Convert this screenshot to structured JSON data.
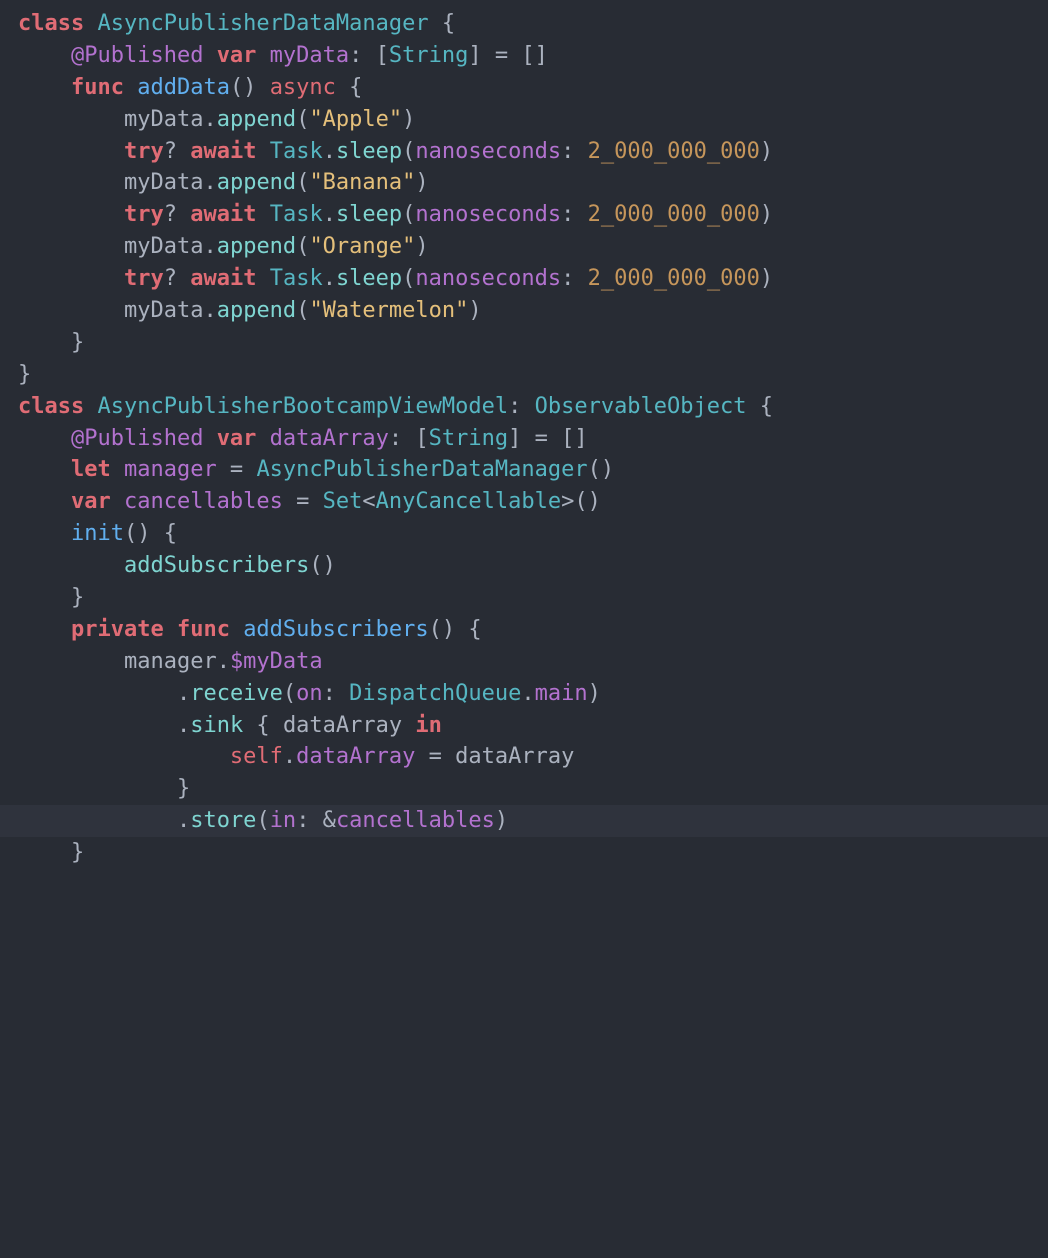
{
  "language": "swift",
  "theme": "one-dark",
  "highlighted_line_index": 34,
  "lines": [
    {
      "indent": 0,
      "tokens": [
        {
          "t": "class ",
          "c": "kw-strong"
        },
        {
          "t": "AsyncPublisherDataManager",
          "c": "type"
        },
        {
          "t": " {",
          "c": "punct"
        }
      ]
    },
    {
      "indent": 1,
      "tokens": [
        {
          "t": "@Published ",
          "c": "attr"
        },
        {
          "t": "var ",
          "c": "kw-strong"
        },
        {
          "t": "myData",
          "c": "prop"
        },
        {
          "t": ": [",
          "c": "punct"
        },
        {
          "t": "String",
          "c": "type2"
        },
        {
          "t": "] = []",
          "c": "punct"
        }
      ]
    },
    {
      "indent": 0,
      "tokens": [
        {
          "t": "",
          "c": "punct"
        }
      ]
    },
    {
      "indent": 1,
      "tokens": [
        {
          "t": "func ",
          "c": "kw-strong"
        },
        {
          "t": "addData",
          "c": "def"
        },
        {
          "t": "() ",
          "c": "punct"
        },
        {
          "t": "async",
          "c": "async"
        },
        {
          "t": " {",
          "c": "punct"
        }
      ]
    },
    {
      "indent": 2,
      "tokens": [
        {
          "t": "myData",
          "c": "ident"
        },
        {
          "t": ".",
          "c": "punct"
        },
        {
          "t": "append",
          "c": "fn"
        },
        {
          "t": "(",
          "c": "punct"
        },
        {
          "t": "\"Apple\"",
          "c": "str"
        },
        {
          "t": ")",
          "c": "punct"
        }
      ]
    },
    {
      "indent": 2,
      "tokens": [
        {
          "t": "try",
          "c": "kw-strong"
        },
        {
          "t": "? ",
          "c": "punct"
        },
        {
          "t": "await ",
          "c": "kw-strong"
        },
        {
          "t": "Task",
          "c": "type2"
        },
        {
          "t": ".",
          "c": "punct"
        },
        {
          "t": "sleep",
          "c": "fn"
        },
        {
          "t": "(",
          "c": "punct"
        },
        {
          "t": "nanoseconds",
          "c": "prop"
        },
        {
          "t": ": ",
          "c": "punct"
        },
        {
          "t": "2_000_000_000",
          "c": "num"
        },
        {
          "t": ")",
          "c": "punct"
        }
      ]
    },
    {
      "indent": 2,
      "tokens": [
        {
          "t": "myData",
          "c": "ident"
        },
        {
          "t": ".",
          "c": "punct"
        },
        {
          "t": "append",
          "c": "fn"
        },
        {
          "t": "(",
          "c": "punct"
        },
        {
          "t": "\"Banana\"",
          "c": "str"
        },
        {
          "t": ")",
          "c": "punct"
        }
      ]
    },
    {
      "indent": 2,
      "tokens": [
        {
          "t": "try",
          "c": "kw-strong"
        },
        {
          "t": "? ",
          "c": "punct"
        },
        {
          "t": "? ",
          "c": "hidden"
        },
        {
          "t": "await ",
          "c": "kw-strong"
        },
        {
          "t": "Task",
          "c": "type2"
        },
        {
          "t": ".",
          "c": "punct"
        },
        {
          "t": "sleep",
          "c": "fn"
        },
        {
          "t": "(",
          "c": "punct"
        },
        {
          "t": "nanoseconds",
          "c": "prop"
        },
        {
          "t": ": ",
          "c": "punct"
        },
        {
          "t": "2_000_000_000",
          "c": "num"
        },
        {
          "t": ")",
          "c": "punct"
        }
      ],
      "fix7": true
    },
    {
      "indent": 2,
      "tokens": [
        {
          "t": "myData",
          "c": "ident"
        },
        {
          "t": ".",
          "c": "punct"
        },
        {
          "t": "append",
          "c": "fn"
        },
        {
          "t": "(",
          "c": "punct"
        },
        {
          "t": "\"Orange\"",
          "c": "str"
        },
        {
          "t": ")",
          "c": "punct"
        }
      ]
    },
    {
      "indent": 2,
      "tokens": [
        {
          "t": "try",
          "c": "kw-strong"
        },
        {
          "t": "? ",
          "c": "punct"
        },
        {
          "t": "await ",
          "c": "kw-strong"
        },
        {
          "t": "Task",
          "c": "type2"
        },
        {
          "t": ".",
          "c": "punct"
        },
        {
          "t": "sleep",
          "c": "fn"
        },
        {
          "t": "(",
          "c": "punct"
        },
        {
          "t": "nanoseconds",
          "c": "prop"
        },
        {
          "t": ": ",
          "c": "punct"
        },
        {
          "t": "2_000_000_000",
          "c": "num"
        },
        {
          "t": ")",
          "c": "punct"
        }
      ]
    },
    {
      "indent": 2,
      "tokens": [
        {
          "t": "myData",
          "c": "ident"
        },
        {
          "t": ".",
          "c": "punct"
        },
        {
          "t": "append",
          "c": "fn"
        },
        {
          "t": "(",
          "c": "punct"
        },
        {
          "t": "\"Watermelon\"",
          "c": "str"
        },
        {
          "t": ")",
          "c": "punct"
        }
      ]
    },
    {
      "indent": 1,
      "tokens": [
        {
          "t": "}",
          "c": "punct"
        }
      ]
    },
    {
      "indent": 0,
      "tokens": [
        {
          "t": "}",
          "c": "punct"
        }
      ]
    },
    {
      "indent": 0,
      "tokens": [
        {
          "t": "",
          "c": "punct"
        }
      ]
    },
    {
      "indent": 0,
      "tokens": [
        {
          "t": "",
          "c": "punct"
        }
      ]
    },
    {
      "indent": 0,
      "tokens": [
        {
          "t": "",
          "c": "punct"
        }
      ]
    },
    {
      "indent": 0,
      "tokens": [
        {
          "t": "class ",
          "c": "kw-strong"
        },
        {
          "t": "AsyncPublisherBootcampViewModel",
          "c": "type"
        },
        {
          "t": ": ",
          "c": "punct"
        },
        {
          "t": "ObservableObject",
          "c": "type2"
        },
        {
          "t": " {",
          "c": "punct"
        }
      ]
    },
    {
      "indent": 1,
      "tokens": [
        {
          "t": "@Published ",
          "c": "attr"
        },
        {
          "t": "var ",
          "c": "kw-strong"
        },
        {
          "t": "dataArray",
          "c": "prop"
        },
        {
          "t": ": [",
          "c": "punct"
        },
        {
          "t": "String",
          "c": "type2"
        },
        {
          "t": "] = []",
          "c": "punct"
        }
      ]
    },
    {
      "indent": 1,
      "tokens": [
        {
          "t": "let ",
          "c": "kw-strong"
        },
        {
          "t": "manager",
          "c": "prop"
        },
        {
          "t": " = ",
          "c": "punct"
        },
        {
          "t": "AsyncPublisherDataManager",
          "c": "type"
        },
        {
          "t": "()",
          "c": "punct"
        }
      ]
    },
    {
      "indent": 1,
      "tokens": [
        {
          "t": "var ",
          "c": "kw-strong"
        },
        {
          "t": "cancellables",
          "c": "prop"
        },
        {
          "t": " = ",
          "c": "punct"
        },
        {
          "t": "Set",
          "c": "type2"
        },
        {
          "t": "<",
          "c": "punct"
        },
        {
          "t": "AnyCancellable",
          "c": "type2"
        },
        {
          "t": ">()",
          "c": "punct"
        }
      ]
    },
    {
      "indent": 0,
      "tokens": [
        {
          "t": "",
          "c": "punct"
        }
      ]
    },
    {
      "indent": 1,
      "tokens": [
        {
          "t": "init",
          "c": "def"
        },
        {
          "t": "() {",
          "c": "punct"
        }
      ]
    },
    {
      "indent": 2,
      "tokens": [
        {
          "t": "addSubscribers",
          "c": "fn"
        },
        {
          "t": "()",
          "c": "punct"
        }
      ]
    },
    {
      "indent": 1,
      "tokens": [
        {
          "t": "}",
          "c": "punct"
        }
      ]
    },
    {
      "indent": 0,
      "tokens": [
        {
          "t": "",
          "c": "punct"
        }
      ]
    },
    {
      "indent": 1,
      "tokens": [
        {
          "t": "private ",
          "c": "kw-strong"
        },
        {
          "t": "func ",
          "c": "kw-strong"
        },
        {
          "t": "addSubscribers",
          "c": "def"
        },
        {
          "t": "() {",
          "c": "punct"
        }
      ]
    },
    {
      "indent": 2,
      "tokens": [
        {
          "t": "manager",
          "c": "ident"
        },
        {
          "t": ".",
          "c": "punct"
        },
        {
          "t": "$myData",
          "c": "prop"
        }
      ]
    },
    {
      "indent": 3,
      "tokens": [
        {
          "t": ".",
          "c": "punct"
        },
        {
          "t": "receive",
          "c": "fn"
        },
        {
          "t": "(",
          "c": "punct"
        },
        {
          "t": "on",
          "c": "prop"
        },
        {
          "t": ": ",
          "c": "punct"
        },
        {
          "t": "DispatchQueue",
          "c": "type2"
        },
        {
          "t": ".",
          "c": "punct"
        },
        {
          "t": "main",
          "c": "prop"
        },
        {
          "t": ")",
          "c": "punct"
        }
      ]
    },
    {
      "indent": 3,
      "tokens": [
        {
          "t": ".",
          "c": "punct"
        },
        {
          "t": "sink",
          "c": "fn"
        },
        {
          "t": " { ",
          "c": "punct"
        },
        {
          "t": "dataArray ",
          "c": "ident"
        },
        {
          "t": "in",
          "c": "kw-strong"
        }
      ]
    },
    {
      "indent": 4,
      "tokens": [
        {
          "t": "self",
          "c": "selfkw"
        },
        {
          "t": ".",
          "c": "punct"
        },
        {
          "t": "dataArray",
          "c": "prop"
        },
        {
          "t": " = ",
          "c": "punct"
        },
        {
          "t": "dataArray",
          "c": "ident"
        }
      ]
    },
    {
      "indent": 3,
      "tokens": [
        {
          "t": "}",
          "c": "punct"
        }
      ]
    },
    {
      "indent": 3,
      "tokens": [
        {
          "t": ".",
          "c": "punct"
        },
        {
          "t": "store",
          "c": "fn"
        },
        {
          "t": "(",
          "c": "punct"
        },
        {
          "t": "in",
          "c": "prop"
        },
        {
          "t": ": &",
          "c": "punct"
        },
        {
          "t": "cancellables",
          "c": "prop"
        },
        {
          "t": ")",
          "c": "punct"
        }
      ],
      "highlight": true
    },
    {
      "indent": 1,
      "tokens": [
        {
          "t": "}",
          "c": "punct"
        }
      ]
    }
  ]
}
